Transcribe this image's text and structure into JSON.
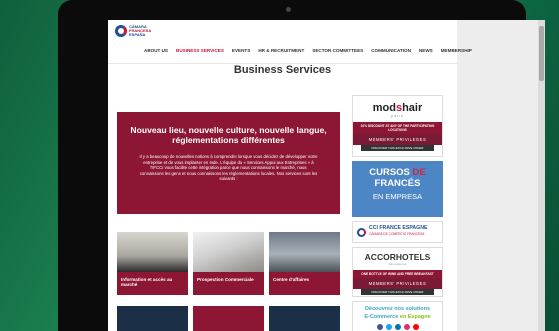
{
  "logo": {
    "line1": "CÁMARA",
    "line2": "FRANCESA",
    "line3": "ESPAÑA"
  },
  "nav": [
    {
      "label": "ABOUT US"
    },
    {
      "label": "BUSINESS SERVICES"
    },
    {
      "label": "EVENTS"
    },
    {
      "label": "HR & RECRUITMENT"
    },
    {
      "label": "SECTOR COMMITTEES"
    },
    {
      "label": "COMMUNICATION"
    },
    {
      "label": "NEWS"
    },
    {
      "label": "MEMBERSHIP"
    }
  ],
  "page_title": "Business Services",
  "hero": {
    "title": "Nouveau lieu, nouvelle culture, nouvelle langue, réglementations différentes",
    "text": "Il y a beaucoup de nouvelles notions à comprendre lorsque vous décidez de développer votre entreprise et de vous implanter en Inde. L'équipe du « Services Appui aux Entreprises » à l'IFCCI vous facilite cette intégration parce que nous connaissons le marché, nous connaissons les gens et nous connaissons les réglementations locales. Nos services sont les suivants :"
  },
  "cards": [
    {
      "label": "Information et accès au marché"
    },
    {
      "label": "Prospection Commerciale"
    },
    {
      "label": "Centre d'affaires"
    }
  ],
  "ads": {
    "mod_logo_a": "mod",
    "mod_logo_b": "s",
    "mod_logo_c": "hair",
    "mod_sub": "paris",
    "mod_band": "10% DISCOUNT AT ANY OF THE PARTICIPATING LOCATIONS",
    "privileges": "MEMBERS' PRIVILEGES",
    "discover": "DISCOVER THIS EXCLUSIVE OFFER",
    "cursos_a": "CURSOS",
    "cursos_b": "DE",
    "cursos_c": "FRANCÉS",
    "cursos_line2": "EN EMPRESA",
    "cci_title": "CCI FRANCE ESPAGNE",
    "cci_sub": "CÁMARA DE COMERCIO FRANCESA",
    "accor_logo": "ACCORHOTELS",
    "accor_sub": "feel welcome",
    "accor_band": "ONE BOTTLE OF WINE AND FREE BREAKFAST",
    "ecom_line1": "Découvrez nos solutions",
    "ecom_a": "E-Commerce",
    "ecom_b": "en Espagne"
  },
  "colors": {
    "brand_red": "#8c1633",
    "brand_blue": "#1e4f9a",
    "accent": "#c6163b"
  }
}
